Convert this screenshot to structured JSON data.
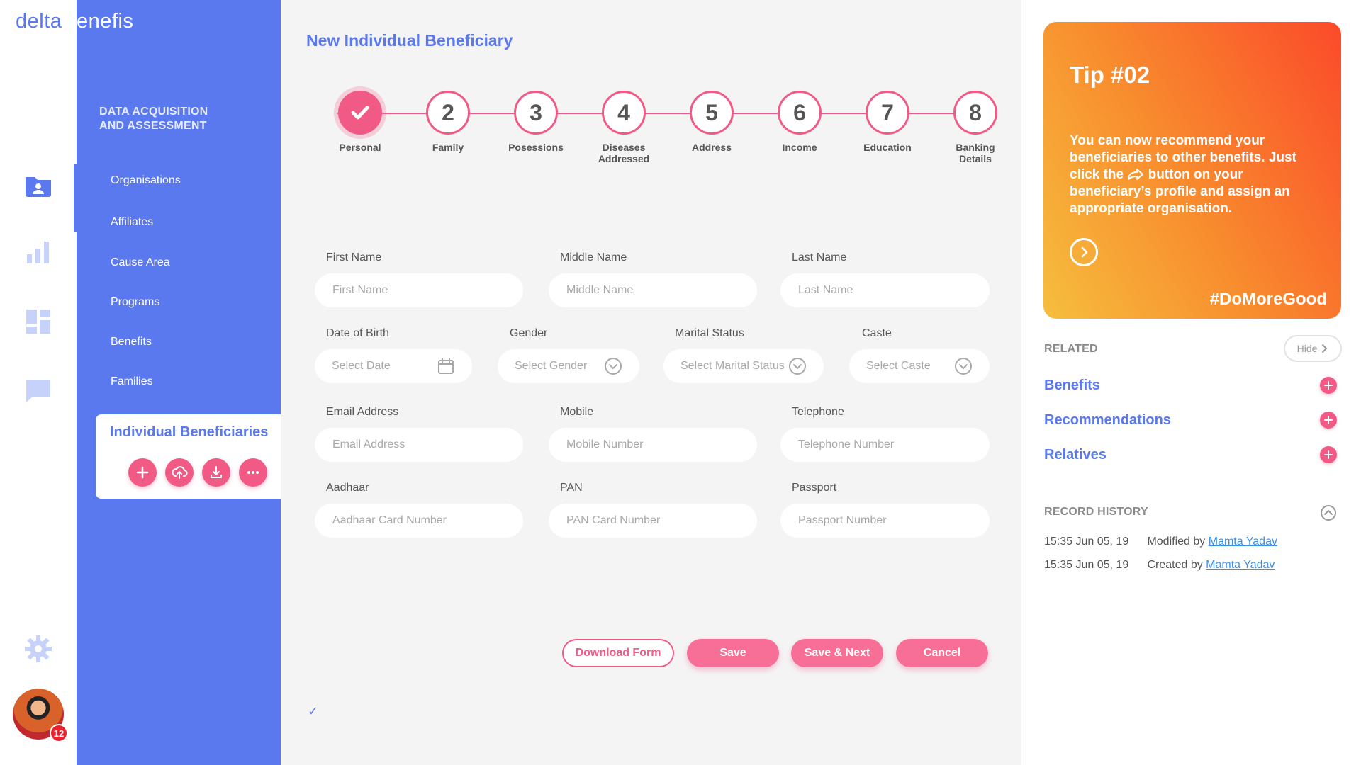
{
  "brand": {
    "part1": "delta",
    "part2": "benefis"
  },
  "rail": {
    "notification_count": "12"
  },
  "sidebar": {
    "heading": "DATA ACQUISITION\nAND ASSESSMENT",
    "items": [
      "Organisations",
      "Affiliates",
      "Cause Area",
      "Programs",
      "Benefits",
      "Families"
    ],
    "active": "Individual Beneficiaries"
  },
  "page": {
    "title": "New Individual Beneficiary"
  },
  "steps": [
    {
      "number": "",
      "label": "Personal"
    },
    {
      "number": "2",
      "label": "Family"
    },
    {
      "number": "3",
      "label": "Posessions"
    },
    {
      "number": "4",
      "label": "Diseases Addressed"
    },
    {
      "number": "5",
      "label": "Address"
    },
    {
      "number": "6",
      "label": "Income"
    },
    {
      "number": "7",
      "label": "Education"
    },
    {
      "number": "8",
      "label": "Banking Details"
    }
  ],
  "form": {
    "first_name": {
      "label": "First Name",
      "placeholder": "First Name"
    },
    "middle_name": {
      "label": "Middle Name",
      "placeholder": "Middle Name"
    },
    "last_name": {
      "label": "Last Name",
      "placeholder": "Last Name"
    },
    "dob": {
      "label": "Date of Birth",
      "placeholder": "Select Date"
    },
    "gender": {
      "label": "Gender",
      "placeholder": "Select Gender"
    },
    "marital": {
      "label": "Marital Status",
      "placeholder": "Select Marital Status"
    },
    "caste": {
      "label": "Caste",
      "placeholder": "Select Caste"
    },
    "email": {
      "label": "Email Address",
      "placeholder": "Email Address"
    },
    "mobile": {
      "label": "Mobile",
      "placeholder": "Mobile Number"
    },
    "telephone": {
      "label": "Telephone",
      "placeholder": "Telephone Number"
    },
    "aadhaar": {
      "label": "Aadhaar",
      "placeholder": "Aadhaar Card Number"
    },
    "pan": {
      "label": "PAN",
      "placeholder": "PAN Card Number"
    },
    "passport": {
      "label": "Passport",
      "placeholder": "Passport Number"
    }
  },
  "actions": {
    "download": "Download Form",
    "save": "Save",
    "save_next": "Save & Next",
    "cancel": "Cancel"
  },
  "tip": {
    "title": "Tip #02",
    "body_before": "You can now recommend your beneficiaries to other benefits. Just click the",
    "body_after": "button on your beneficiary’s profile and assign an appropriate organisation.",
    "hashtag": "#DoMoreGood"
  },
  "related": {
    "title": "RELATED",
    "hide": "Hide",
    "links": [
      "Benefits",
      "Recommendations",
      "Relatives"
    ]
  },
  "history": {
    "title": "RECORD HISTORY",
    "rows": [
      {
        "time": "15:35 Jun 05, 19",
        "action": "Modified by",
        "user": "Mamta Yadav"
      },
      {
        "time": "15:35 Jun 05, 19",
        "action": "Created by",
        "user": "Mamta Yadav"
      }
    ]
  },
  "colors": {
    "primary": "#5b79ef",
    "accent": "#f25a86",
    "tip_start": "#f6be3e",
    "tip_end": "#fb4a2a"
  },
  "icons": [
    "folder-user-icon",
    "bar-chart-icon",
    "dashboard-icon",
    "chat-icon",
    "gear-icon",
    "plus-icon",
    "upload-cloud-icon",
    "download-icon",
    "more-icon",
    "calendar-icon",
    "chevron-down-icon",
    "share-icon",
    "arrow-right-icon",
    "chevron-right-icon",
    "chevron-up-icon"
  ]
}
